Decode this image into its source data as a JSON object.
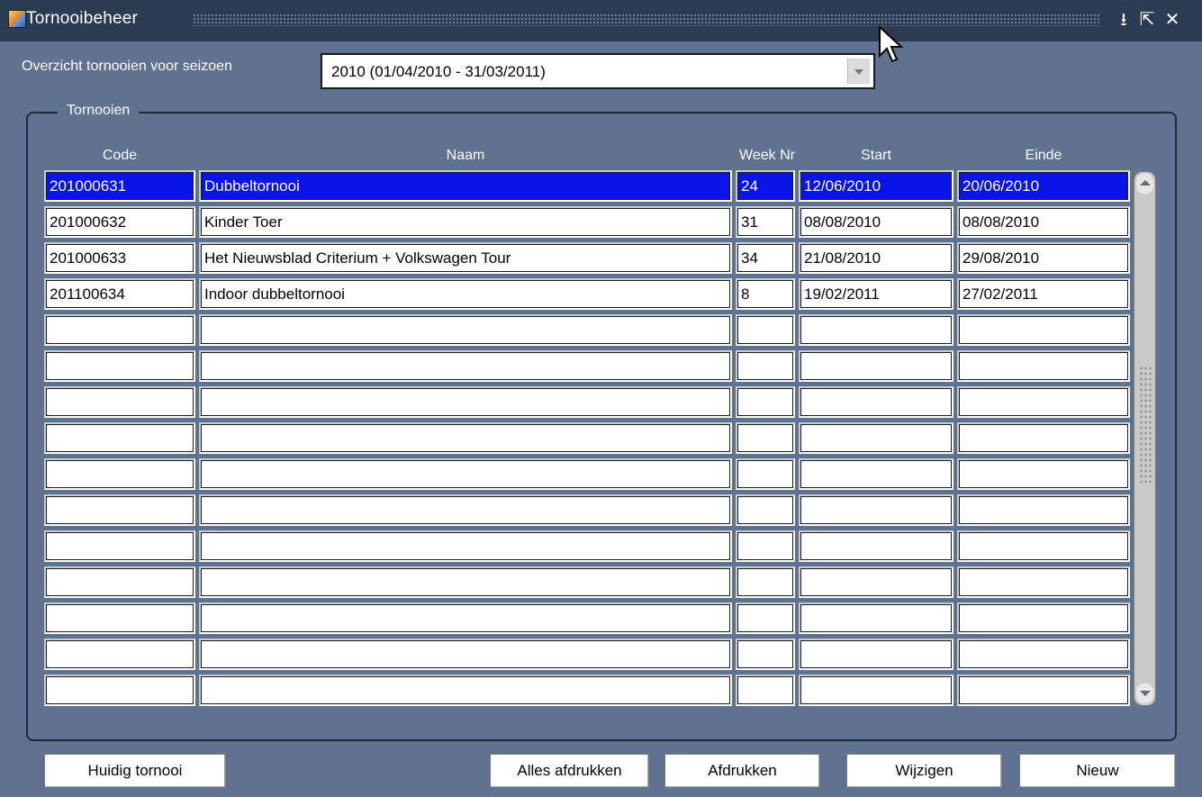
{
  "window": {
    "title": "Tornooibeheer",
    "controls": {
      "minimize": "⭳",
      "maximize": "⇱",
      "close": "✕"
    }
  },
  "season": {
    "label": "Overzicht tornooien voor seizoen",
    "selected": "2010 (01/04/2010 - 31/03/2011)"
  },
  "group": {
    "title": "Tornooien"
  },
  "table": {
    "headers": {
      "code": "Code",
      "naam": "Naam",
      "week": "Week Nr",
      "start": "Start",
      "einde": "Einde"
    },
    "rows": [
      {
        "code": "201000631",
        "naam": "Dubbeltornooi",
        "week": "24",
        "start": "12/06/2010",
        "einde": "20/06/2010"
      },
      {
        "code": "201000632",
        "naam": "Kinder Toer",
        "week": "31",
        "start": "08/08/2010",
        "einde": "08/08/2010"
      },
      {
        "code": "201000633",
        "naam": "Het Nieuwsblad Criterium + Volkswagen Tour",
        "week": "34",
        "start": "21/08/2010",
        "einde": "29/08/2010"
      },
      {
        "code": "201100634",
        "naam": "Indoor dubbeltornooi",
        "week": "8",
        "start": "19/02/2011",
        "einde": "27/02/2011"
      },
      {
        "code": "",
        "naam": "",
        "week": "",
        "start": "",
        "einde": ""
      },
      {
        "code": "",
        "naam": "",
        "week": "",
        "start": "",
        "einde": ""
      },
      {
        "code": "",
        "naam": "",
        "week": "",
        "start": "",
        "einde": ""
      },
      {
        "code": "",
        "naam": "",
        "week": "",
        "start": "",
        "einde": ""
      },
      {
        "code": "",
        "naam": "",
        "week": "",
        "start": "",
        "einde": ""
      },
      {
        "code": "",
        "naam": "",
        "week": "",
        "start": "",
        "einde": ""
      },
      {
        "code": "",
        "naam": "",
        "week": "",
        "start": "",
        "einde": ""
      },
      {
        "code": "",
        "naam": "",
        "week": "",
        "start": "",
        "einde": ""
      },
      {
        "code": "",
        "naam": "",
        "week": "",
        "start": "",
        "einde": ""
      },
      {
        "code": "",
        "naam": "",
        "week": "",
        "start": "",
        "einde": ""
      },
      {
        "code": "",
        "naam": "",
        "week": "",
        "start": "",
        "einde": ""
      }
    ]
  },
  "buttons": {
    "huidig": "Huidig tornooi",
    "alles_afdrukken": "Alles afdrukken",
    "afdrukken": "Afdrukken",
    "wijzigen": "Wijzigen",
    "nieuw": "Nieuw"
  },
  "colors": {
    "background": "#5f7391",
    "titlebar": "#2b3b52",
    "selection": "#0b14e6"
  }
}
